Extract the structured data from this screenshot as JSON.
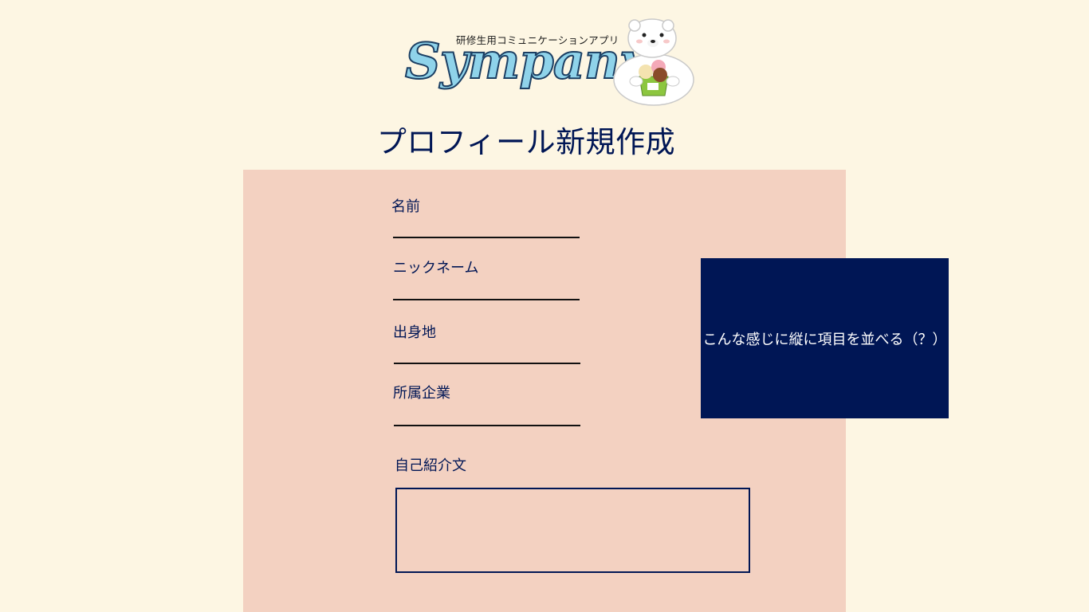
{
  "logo": {
    "tagline": "研修生用コミュニケーションアプリ",
    "wordmark": "Sympany",
    "mascot_icon": "polar-bear-with-ice-cream-icon"
  },
  "page": {
    "title": "プロフィール新規作成"
  },
  "form": {
    "name_label": "名前",
    "nickname_label": "ニックネーム",
    "hometown_label": "出身地",
    "company_label": "所属企業",
    "bio_label": "自己紹介文",
    "name_value": "",
    "nickname_value": "",
    "hometown_value": "",
    "company_value": "",
    "bio_value": ""
  },
  "note": {
    "text": "こんな感じに縦に項目を並べる（？）"
  },
  "colors": {
    "background": "#fdf6e3",
    "panel": "#f3d1c1",
    "accent_navy": "#001655",
    "logo_blue": "#8fd3ea"
  }
}
